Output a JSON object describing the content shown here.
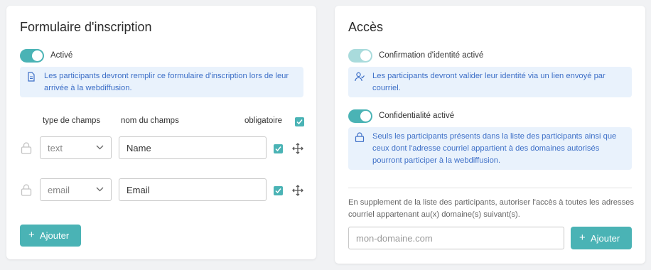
{
  "registration": {
    "title": "Formulaire d'inscription",
    "toggle_label": "Activé",
    "info_text": "Les participants devront remplir ce formulaire d'inscription lors de leur arrivée à la webdiffusion.",
    "columns": {
      "type": "type de champs",
      "name": "nom du champs",
      "required": "obligatoire"
    },
    "fields": [
      {
        "type": "text",
        "name": "Name",
        "required": true
      },
      {
        "type": "email",
        "name": "Email",
        "required": true
      }
    ],
    "add_button": "Ajouter",
    "add_icon": "+"
  },
  "access": {
    "title": "Accès",
    "identity_toggle_label": "Confirmation d'identité activé",
    "identity_info": "Les participants devront valider leur identité via un lien envoyé par courriel.",
    "privacy_toggle_label": "Confidentialité activé",
    "privacy_info": "Seuls les participants présents dans la liste des participants ainsi que ceux dont l'adresse courriel appartient à des domaines autorisés pourront participer à la webdiffusion.",
    "domain_note": "En supplement de la liste des participants, autoriser l'accès à toutes les adresses courriel appartenant au(x) domaine(s) suivant(s).",
    "domain_placeholder": "mon-domaine.com",
    "add_button": "Ajouter",
    "add_icon": "+"
  },
  "colors": {
    "accent": "#4ab3b5",
    "accent_light": "#a9dbdc",
    "info_bg": "#e9f2fc",
    "info_text": "#3d6fc7"
  }
}
